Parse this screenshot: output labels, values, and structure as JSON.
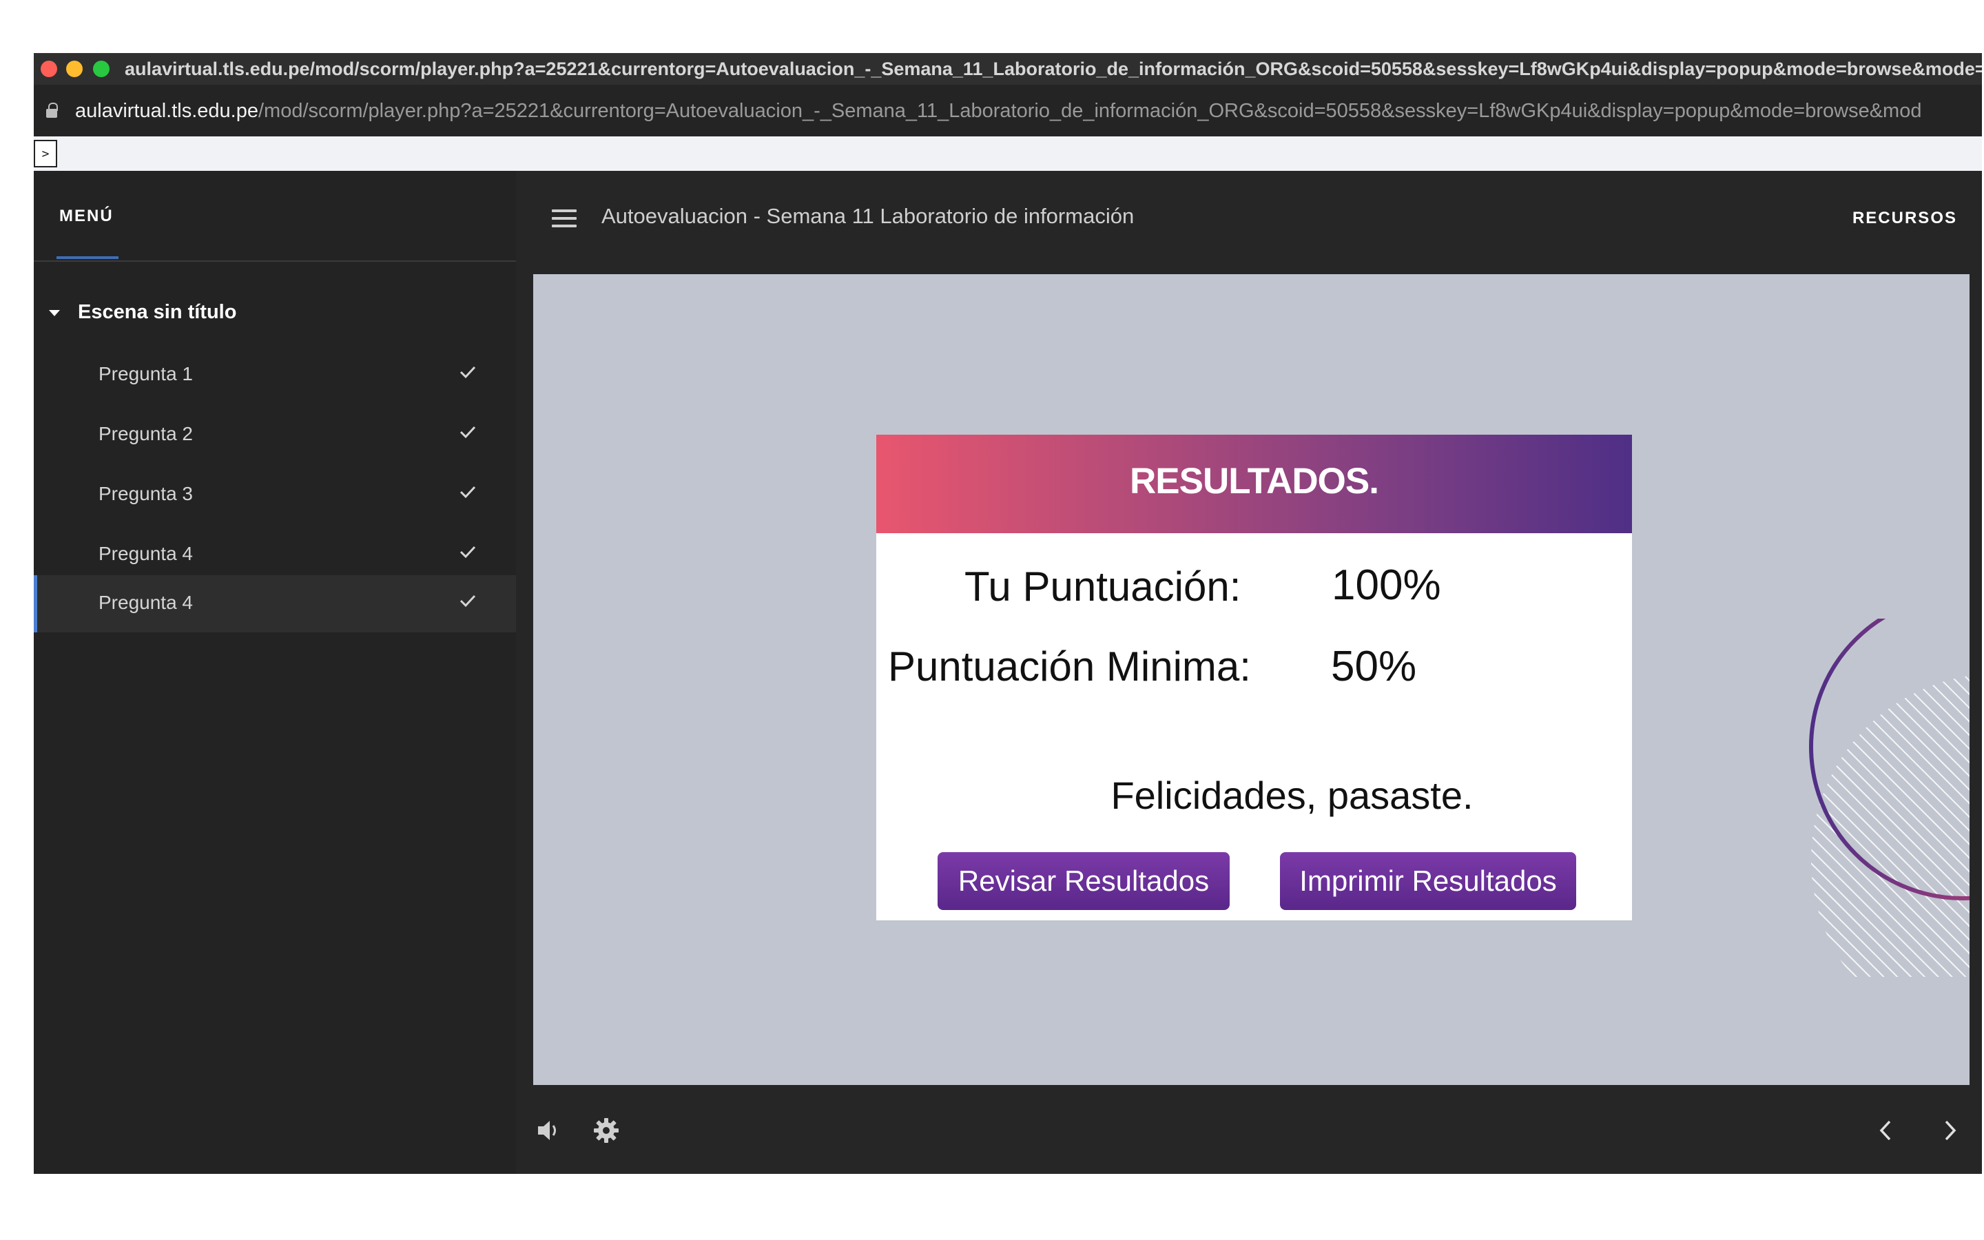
{
  "window": {
    "title": "aulavirtual.tls.edu.pe/mod/scorm/player.php?a=25221&currentorg=Autoevaluacion_-_Semana_11_Laboratorio_de_información_ORG&scoid=50558&sesskey=Lf8wGKp4ui&display=popup&mode=browse&mode=n"
  },
  "address_bar": {
    "host": "aulavirtual.tls.edu.pe",
    "path": "/mod/scorm/player.php?a=25221&currentorg=Autoevaluacion_-_Semana_11_Laboratorio_de_información_ORG&scoid=50558&sesskey=Lf8wGKp4ui&display=popup&mode=browse&mod"
  },
  "devbar": {
    "toggle_label": ">"
  },
  "sidebar": {
    "menu_tab": "MENÚ",
    "scene_label": "Escena sin título",
    "items": [
      {
        "label": "Pregunta 1",
        "completed": true
      },
      {
        "label": "Pregunta 2",
        "completed": true
      },
      {
        "label": "Pregunta 3",
        "completed": true
      },
      {
        "label": "Pregunta 4",
        "completed": true
      },
      {
        "label": "Pregunta 4",
        "completed": true,
        "active": true
      }
    ]
  },
  "header": {
    "course_title": "Autoevaluacion - Semana 11 Laboratorio de información",
    "resources_label": "RECURSOS"
  },
  "results": {
    "title": "RESULTADOS.",
    "score_label": "Tu Puntuación:",
    "score_value": "100%",
    "min_label": "Puntuación Minima:",
    "min_value": "50%",
    "message": "Felicidades, pasaste.",
    "review_button": "Revisar Resultados",
    "print_button": "Imprimir Resultados"
  },
  "colors": {
    "accent_blue": "#4a7fd0",
    "button_purple": "#6a2f99",
    "header_gradient_start": "#e8566e",
    "header_gradient_end": "#4f2f86"
  },
  "icons": [
    "lock-icon",
    "caret-down-icon",
    "check-icon",
    "hamburger-icon",
    "volume-icon",
    "settings-icon",
    "chevron-left-icon",
    "chevron-right-icon"
  ]
}
